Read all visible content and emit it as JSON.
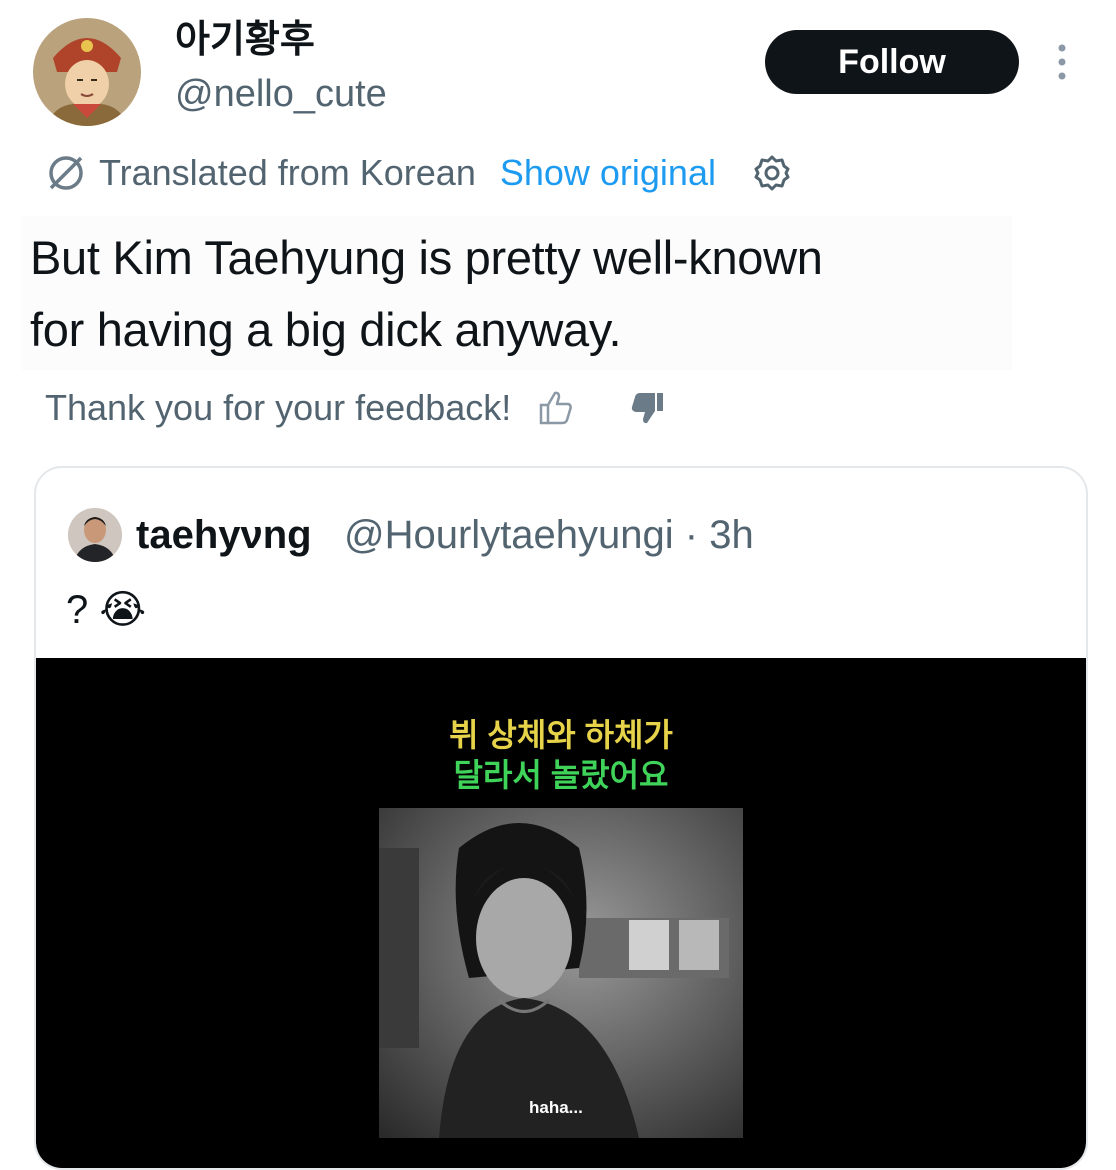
{
  "author": {
    "display_name": "아기황후",
    "handle": "@nello_cute",
    "avatar_icon": "portrait-avatar"
  },
  "follow_label": "Follow",
  "translation": {
    "label": "Translated from Korean",
    "show_original": "Show original"
  },
  "tweet": {
    "line1": "But Kim Taehyung is pretty well-known",
    "line2": "for having a big dick anyway."
  },
  "feedback": {
    "text": "Thank you for your feedback!"
  },
  "quoted": {
    "display_name": "taehyνng",
    "handle": "@Hourlytaehyungi · 3h",
    "text": "? 😭",
    "media": {
      "caption_line1": "뷔 상체와 하체가",
      "caption_line2": "달라서 놀랐어요",
      "subtitle": "haha..."
    }
  },
  "colors": {
    "accent": "#1d9bf0",
    "text": "#0f1419",
    "secondary": "#536471",
    "border": "#e4e8eb"
  }
}
